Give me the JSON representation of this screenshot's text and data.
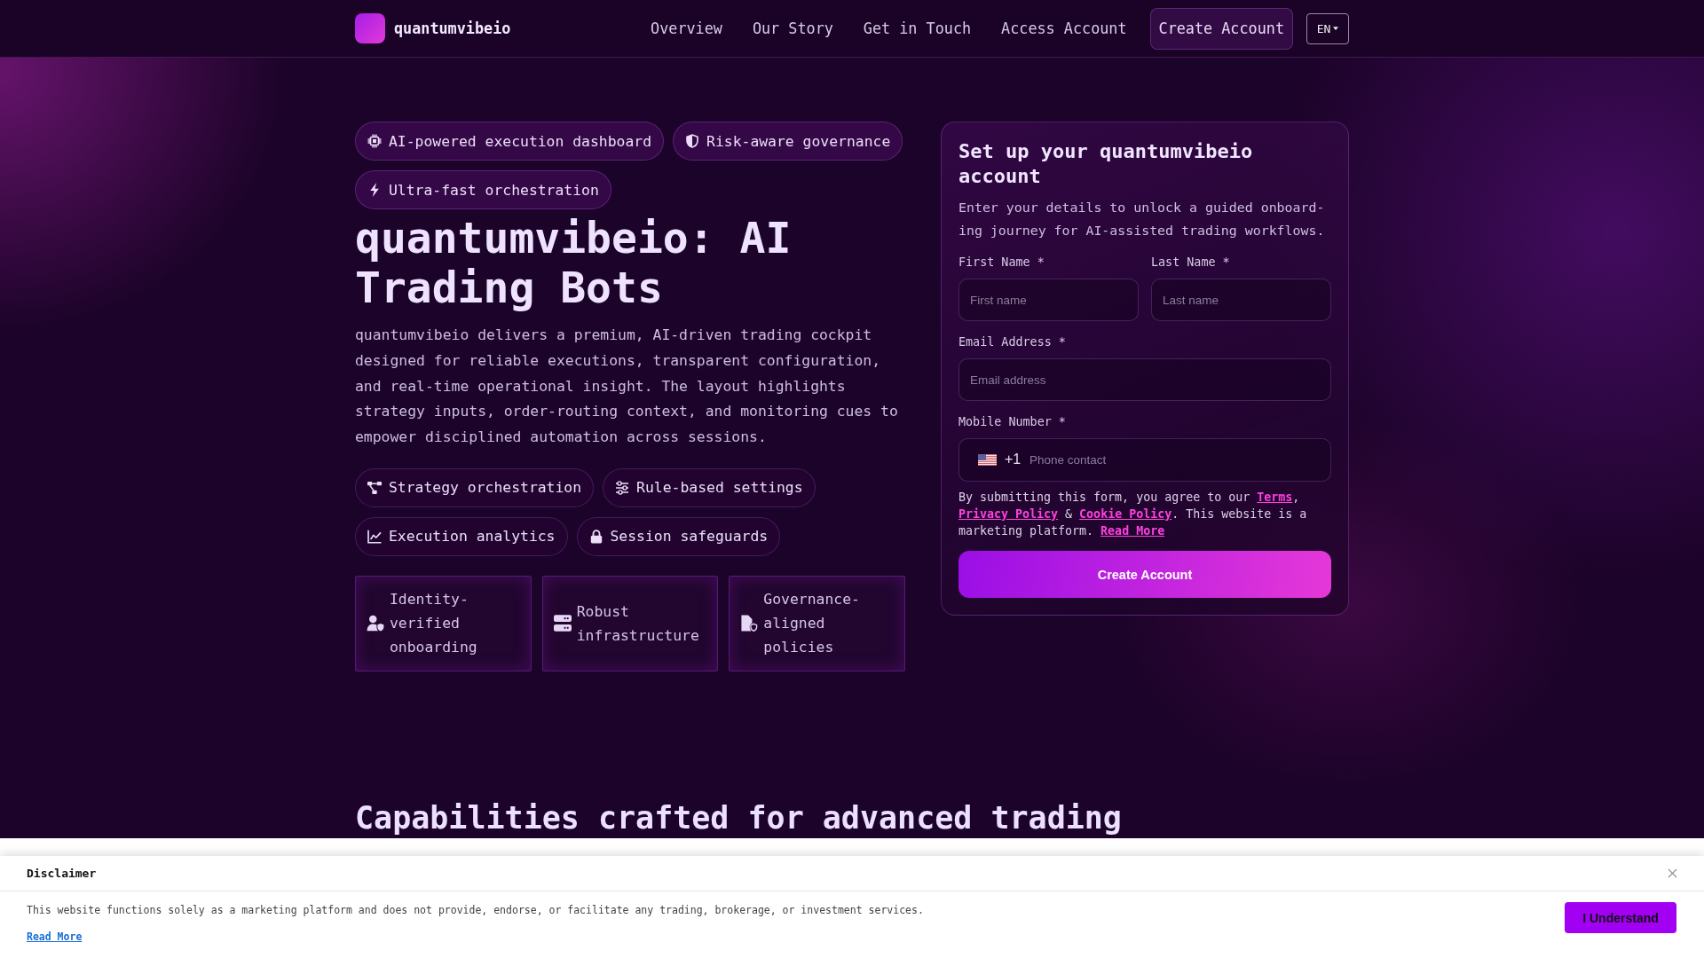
{
  "header": {
    "brand": "quantumvibeio",
    "nav_links": [
      "Overview",
      "Our Story",
      "Get in Touch",
      "Access Account"
    ],
    "cta": "Create Account",
    "language": "EN"
  },
  "hero": {
    "badges": [
      "AI-powered execution dashboard",
      "Risk-aware governance",
      "Ultra-fast orchestration"
    ],
    "title": "quantumvibeio: AI Trading Bots",
    "description": "quantumvibeio delivers a premium, AI-driven trading cockpit designed for reliable executions, transparent configuration, and real-time operational insight. The layout highlights strategy inputs, order-routing context, and monitoring cues to empower disciplined automation across sessions.",
    "features": [
      "Strategy orchestration",
      "Rule-based settings",
      "Execution analytics",
      "Session safeguards"
    ],
    "cards": [
      "Identity-verified onboarding",
      "Robust infrastructure",
      "Governance-aligned policies"
    ]
  },
  "signup_form": {
    "title": "Set up your quantumvibeio account",
    "description_lines": [
      "Enter your details to unlock a guided onboard-",
      "ing journey for AI-assisted trading workflows."
    ],
    "field_rows": [
      [
        {
          "kind": "text",
          "label": "First Name *",
          "placeholder": "First name"
        },
        {
          "kind": "text",
          "label": "Last Name *",
          "placeholder": "Last name"
        }
      ],
      [
        {
          "kind": "email",
          "label": "Email Address *",
          "placeholder": "Email address"
        }
      ],
      [
        {
          "kind": "phone",
          "label": "Mobile Number *",
          "dial_code": "+1",
          "placeholder": "Phone contact"
        }
      ]
    ],
    "consent": [
      {
        "kind": "text",
        "text": "By submitting this form, you agree to our "
      },
      {
        "kind": "link",
        "text": "Terms"
      },
      {
        "kind": "text",
        "text": ", "
      },
      {
        "kind": "link",
        "text": "Privacy Policy"
      },
      {
        "kind": "text",
        "text": " & "
      },
      {
        "kind": "link",
        "text": "Cookie Policy"
      },
      {
        "kind": "text",
        "text": ". This website is a marketing platform. "
      },
      {
        "kind": "link",
        "text": "Read More"
      }
    ],
    "submit": "Create Account"
  },
  "capabilities": {
    "title": "Capabilities crafted for advanced trading"
  },
  "disclaimer": {
    "title": "Disclaimer",
    "text": "This website functions solely as a marketing platform and does not provide, endorse, or facilitate any trading, brokerage, or investment services.",
    "link": "Read More",
    "button": "I Understand"
  }
}
